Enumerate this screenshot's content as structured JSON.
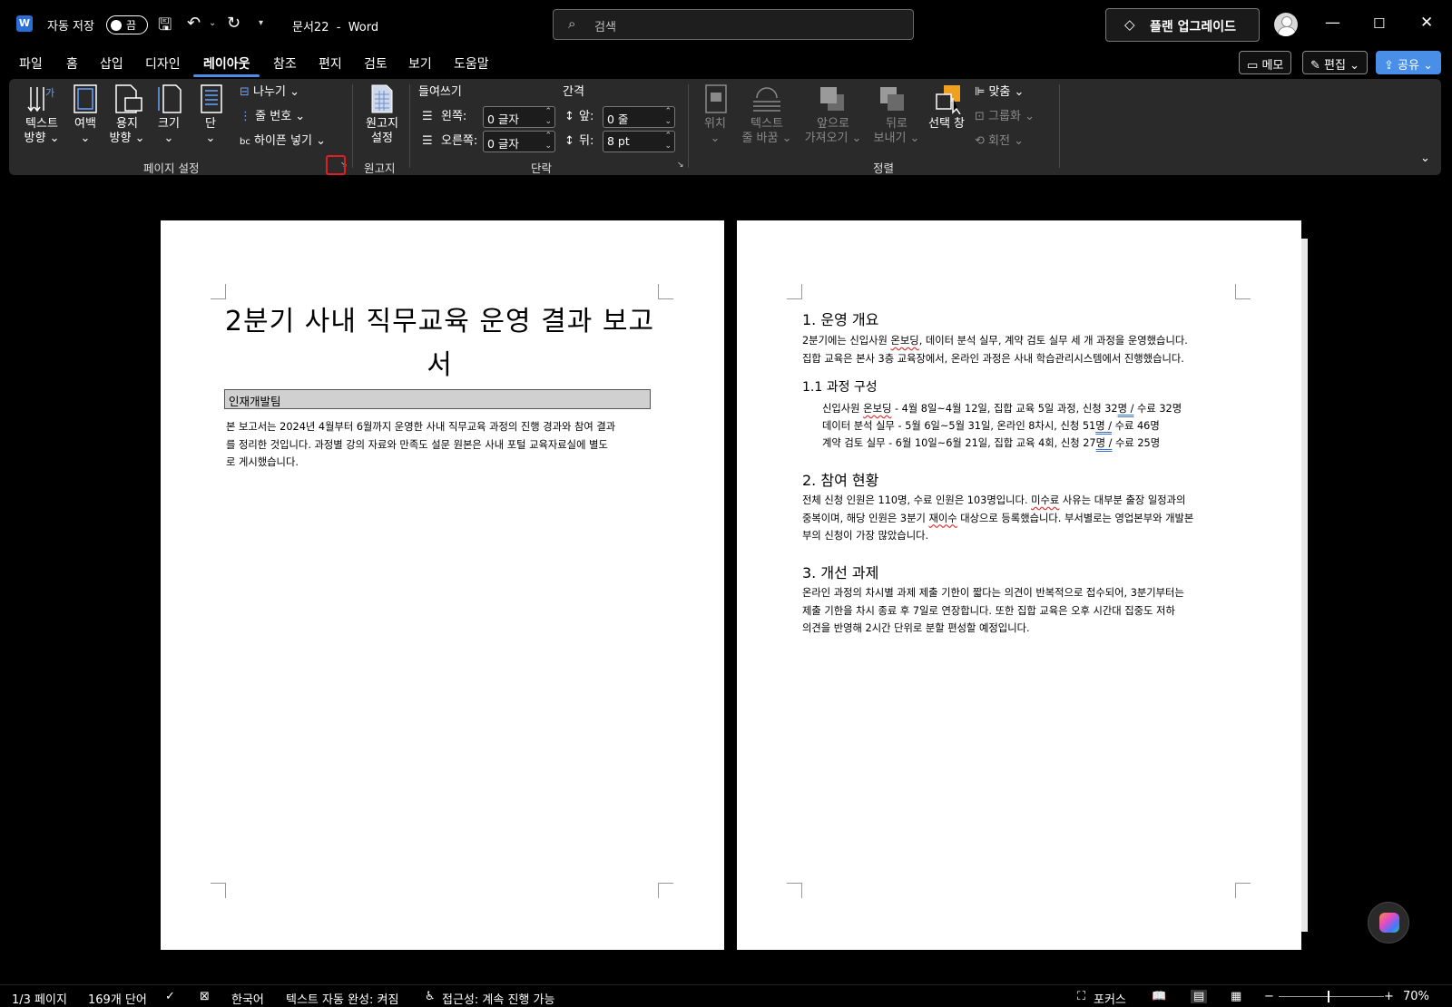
{
  "titlebar": {
    "autosave_label": "자동 저장",
    "autosave_state": "끔",
    "doc_name": "문서22",
    "app_name": "Word",
    "search_placeholder": "검색",
    "upgrade_label": "플랜 업그레이드"
  },
  "menu": {
    "tabs": [
      "파일",
      "홈",
      "삽입",
      "디자인",
      "레이아웃",
      "참조",
      "편지",
      "검토",
      "보기",
      "도움말"
    ],
    "active_tab": "레이아웃",
    "memo": "메모",
    "edit": "편집",
    "share": "공유"
  },
  "ribbon": {
    "page_setup": {
      "text_direction_1": "텍스트",
      "text_direction_2": "방향",
      "margins": "여백",
      "orientation_1": "용지",
      "orientation_2": "방향",
      "size": "크기",
      "columns": "단",
      "breaks": "나누기",
      "line_numbers": "줄 번호",
      "hyphenation": "하이픈 넣기",
      "label": "페이지 설정"
    },
    "manuscript": {
      "btn_1": "원고지",
      "btn_2": "설정",
      "label": "원고지"
    },
    "paragraph": {
      "indent_header": "들여쓰기",
      "spacing_header": "간격",
      "left_label": "왼쪽:",
      "left_value": "0 글자",
      "right_label": "오른쪽:",
      "right_value": "0 글자",
      "before_label": "앞:",
      "before_value": "0 줄",
      "after_label": "뒤:",
      "after_value": "8 pt",
      "label": "단락"
    },
    "arrange": {
      "position": "위치",
      "wrap_1": "텍스트",
      "wrap_2": "줄 바꿈",
      "forward_1": "앞으로",
      "forward_2": "가져오기",
      "backward_1": "뒤로",
      "backward_2": "보내기",
      "selection_pane": "선택 창",
      "align": "맞춤",
      "group": "그룹화",
      "rotate": "회전",
      "label": "정렬"
    }
  },
  "page1": {
    "title_line1": "2분기 사내 직무교육 운영 결과 보고",
    "title_line2": "서",
    "author": "인재개발팀",
    "body_line1": "본 보고서는 2024년 4월부터 6월까지 운영한 사내 직무교육 과정의 진행 경과와 참여 결과",
    "body_line2": "를 정리한 것입니다. 과정별 강의 자료와 만족도 설문 원본은 사내 포털 교육자료실에 별도",
    "body_line3": "로 게시했습니다."
  },
  "page2": {
    "h1": "1. 운영 개요",
    "p1_line1a": "2분기에는 신입사원 ",
    "p1_line1_sq": "온보딩",
    "p1_line1b": ", 데이터 분석 실무, 계약 검토 실무 세 개 과정을 운영했습니다.",
    "p1_line2": "집합 교육은 본사 3층 교육장에서, 온라인 과정은 사내 학습관리시스템에서 진행했습니다.",
    "h1_1": "1.1 과정 구성",
    "li1a": "신입사원 ",
    "li1_sq": "온보딩",
    "li1b": " - 4월 8일~4월 12일, 집합 교육 5일 과정, 신청 32",
    "li1_bl": "명 /",
    "li1c": " 수료 32명",
    "li2a": "데이터 분석 실무 - 5월 6일~5월 31일, 온라인 8차시, 신청 51",
    "li2_bl": "명 /",
    "li2c": " 수료 46명",
    "li3a": "계약 검토 실무 - 6월 10일~6월 21일, 집합 교육 4회, 신청 27",
    "li3_bl": "명 /",
    "li3c": " 수료 25명",
    "h2": "2. 참여 현황",
    "p2_line1a": "전체 신청 인원은 110명, 수료 인원은 103명입니다. ",
    "p2_line1_sq": "미수료",
    "p2_line1b": " 사유는 대부분 출장 일정과의",
    "p2_line2a": "중복이며, 해당 인원은 3분기 ",
    "p2_line2_sq": "재이수",
    "p2_line2b": " 대상으로 등록했습니다. 부서별로는 영업본부와 개발본",
    "p2_line3": "부의 신청이 가장 많았습니다.",
    "h3": "3. 개선 과제",
    "p3_line1": "온라인 과정의 차시별 과제 제출 기한이 짧다는 의견이 반복적으로 접수되어, 3분기부터는",
    "p3_line2": "제출 기한을 차시 종료 후 7일로 연장합니다. 또한 집합 교육은 오후 시간대 집중도 저하",
    "p3_line3": "의견을 반영해 2시간 단위로 분할 편성할 예정입니다."
  },
  "status": {
    "page": "1/3 페이지",
    "words": "169개 단어",
    "language": "한국어",
    "autocomplete": "텍스트 자동 완성: 켜짐",
    "accessibility": "접근성: 계속 진행 가능",
    "focus": "포커스",
    "zoom": "70%"
  }
}
